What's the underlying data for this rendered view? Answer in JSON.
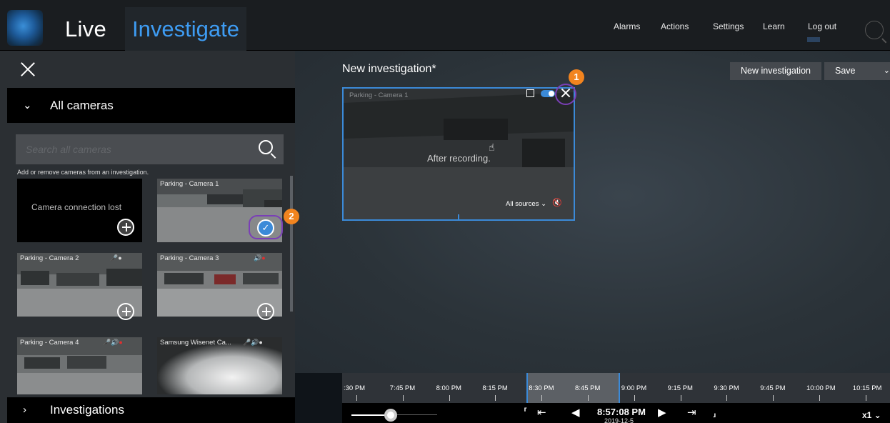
{
  "header": {
    "tabs": [
      {
        "label": "Live"
      },
      {
        "label": "Investigate"
      }
    ],
    "nav": [
      "Alarms",
      "Actions",
      "Settings",
      "Learn",
      "Log out"
    ]
  },
  "left_panel": {
    "all_cameras_label": "All cameras",
    "search_placeholder": "Search all cameras",
    "hint": "Add or remove cameras from an investigation.",
    "cameras": [
      {
        "title": "",
        "status": "Camera connection lost"
      },
      {
        "title": "Parking - Camera 1"
      },
      {
        "title": "Parking - Camera 2"
      },
      {
        "title": "Parking - Camera 3"
      },
      {
        "title": "Parking - Camera 4"
      },
      {
        "title": "Samsung Wisenet Ca..."
      }
    ],
    "investigations_label": "Investigations"
  },
  "main": {
    "title": "New investigation*",
    "new_investigation_label": "New investigation",
    "save_label": "Save",
    "view": {
      "title": "Parking - Camera 1",
      "overlay_text": "After recording.",
      "sources_label": "All sources ⌄"
    }
  },
  "annotations": {
    "badge1": "1",
    "badge2": "2"
  },
  "timeline": {
    "ticks": [
      ":30 PM",
      "7:45 PM",
      "8:00 PM",
      "8:15 PM",
      "8:30 PM",
      "8:45 PM",
      "9:00 PM",
      "9:15 PM",
      "9:30 PM",
      "9:45 PM",
      "10:00 PM",
      "10:15 PM"
    ],
    "current_time": "8:57:08 PM",
    "current_date": "2019-12-5",
    "speed": "x1 ⌄"
  },
  "colors": {
    "accent": "#3b8ad8",
    "badge": "#f2841f",
    "highlight_ring": "#7a3fb6"
  }
}
